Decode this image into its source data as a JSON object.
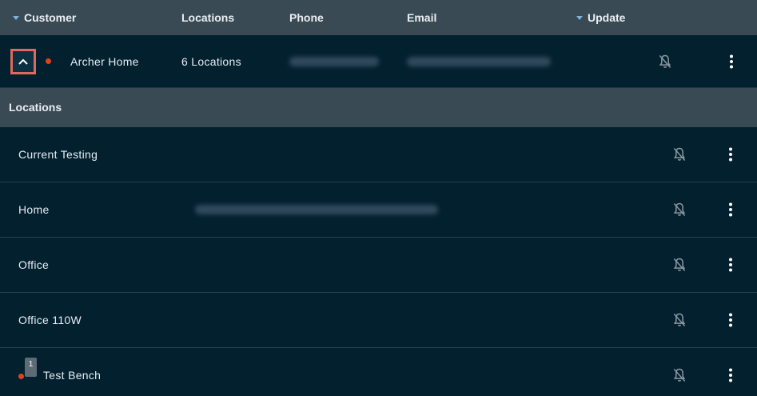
{
  "header": {
    "customer": "Customer",
    "locations": "Locations",
    "phone": "Phone",
    "email": "Email",
    "update": "Update"
  },
  "customer_row": {
    "name": "Archer Home",
    "locations_count": "6 Locations",
    "phone_redacted": "",
    "email_redacted": ""
  },
  "locations_section": {
    "title": "Locations"
  },
  "locations": [
    {
      "name": "Current Testing",
      "badge": ""
    },
    {
      "name": "Home",
      "badge": ""
    },
    {
      "name": "Office",
      "badge": ""
    },
    {
      "name": "Office 110W",
      "badge": ""
    },
    {
      "name": "Test Bench",
      "badge": "1"
    }
  ],
  "icons": {
    "expand": "chevron-up-icon",
    "notifications": "bell-off-icon",
    "more": "more-vertical-icon"
  },
  "colors": {
    "background": "#03202f",
    "header": "#394a55",
    "status_dot": "#e0411b",
    "highlight": "#e0685d"
  }
}
